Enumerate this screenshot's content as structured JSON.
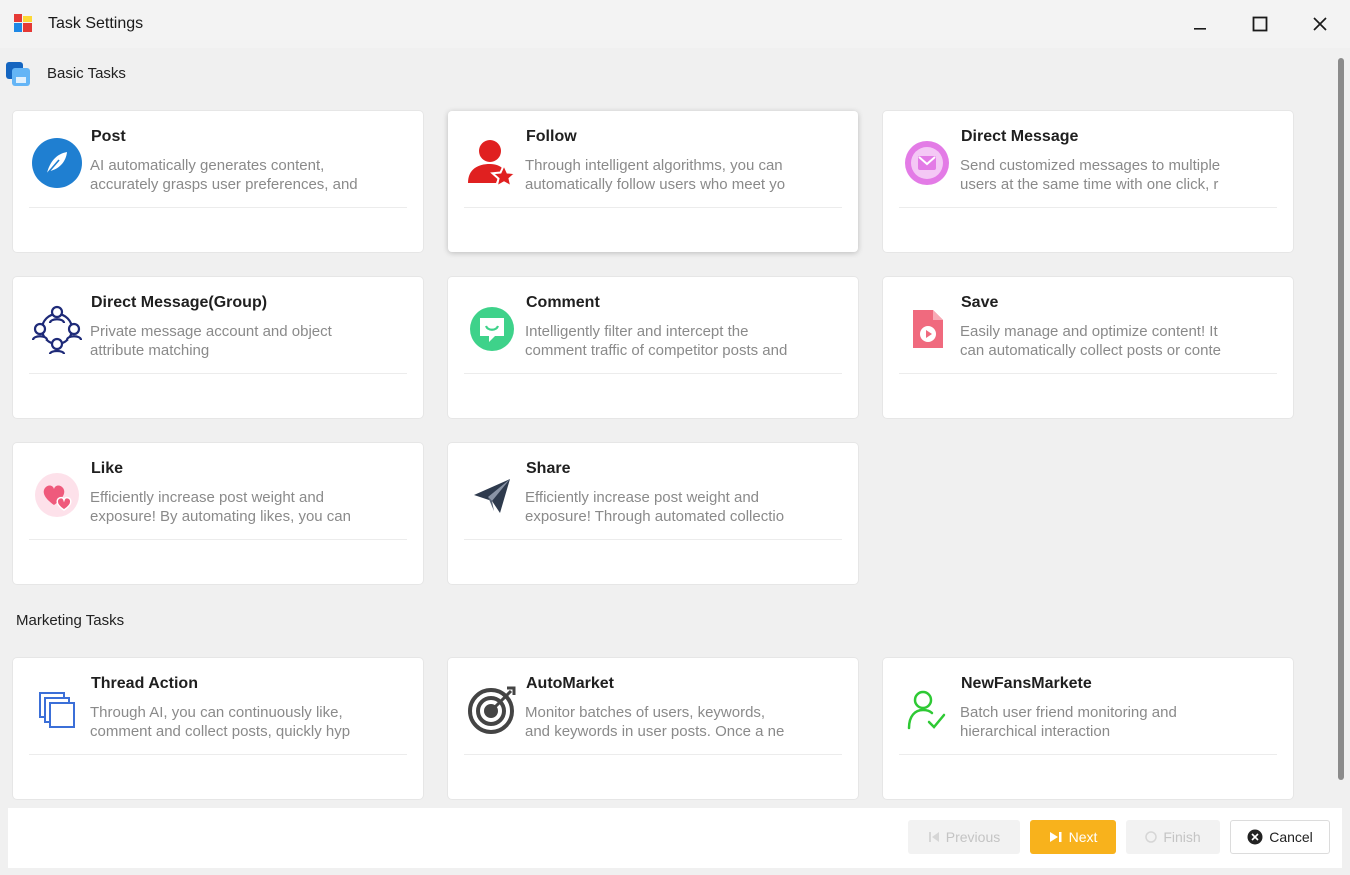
{
  "window": {
    "title": "Task Settings",
    "icon": "app-icon",
    "controls": [
      "minimize-icon",
      "maximize-icon",
      "close-icon"
    ]
  },
  "sections": {
    "basic": "Basic Tasks",
    "marketing": "Marketing Tasks"
  },
  "cards": [
    {
      "id": "post",
      "title": "Post",
      "icon": "feather-icon",
      "desc1": "AI automatically generates content,",
      "desc2": "accurately grasps user preferences, and"
    },
    {
      "id": "follow",
      "title": "Follow",
      "icon": "user-star-icon",
      "desc1": "Through intelligent algorithms, you can",
      "desc2": "automatically follow users who meet yo"
    },
    {
      "id": "direct-message",
      "title": "Direct Message",
      "icon": "message-envelope-icon",
      "desc1": "Send customized messages to multiple",
      "desc2": "users at the same time with one click, r"
    },
    {
      "id": "direct-message-group",
      "title": "Direct Message(Group)",
      "icon": "group-network-icon",
      "desc1": "Private message account and object",
      "desc2": "attribute matching"
    },
    {
      "id": "comment",
      "title": "Comment",
      "icon": "comment-bubble-icon",
      "desc1": "Intelligently filter and intercept the",
      "desc2": "comment traffic of competitor posts and"
    },
    {
      "id": "save",
      "title": "Save",
      "icon": "save-file-icon",
      "desc1": "Easily manage and optimize content! It",
      "desc2": "can automatically collect posts or conte"
    },
    {
      "id": "like",
      "title": "Like",
      "icon": "hearts-icon",
      "desc1": "Efficiently increase post weight and",
      "desc2": "exposure! By automating likes, you can"
    },
    {
      "id": "share",
      "title": "Share",
      "icon": "paper-plane-icon",
      "desc1": "Efficiently increase post weight and",
      "desc2": "exposure! Through automated collectio"
    },
    {
      "id": "thread-action",
      "title": "Thread Action",
      "icon": "stacked-layers-icon",
      "desc1": "Through AI, you can continuously like,",
      "desc2": "comment and collect posts, quickly hyp"
    },
    {
      "id": "automarket",
      "title": "AutoMarket",
      "icon": "target-icon",
      "desc1": "Monitor batches of users, keywords,",
      "desc2": "and keywords in user posts. Once a ne"
    },
    {
      "id": "newfansmarkete",
      "title": "NewFansMarkete",
      "icon": "user-check-icon",
      "desc1": "Batch user friend monitoring and",
      "desc2": "hierarchical interaction"
    }
  ],
  "footer": {
    "previous": "Previous",
    "next": "Next",
    "finish": "Finish",
    "cancel": "Cancel"
  },
  "colors": {
    "accent": "#f8b21c",
    "background": "#f0f0f0",
    "card": "#ffffff"
  }
}
